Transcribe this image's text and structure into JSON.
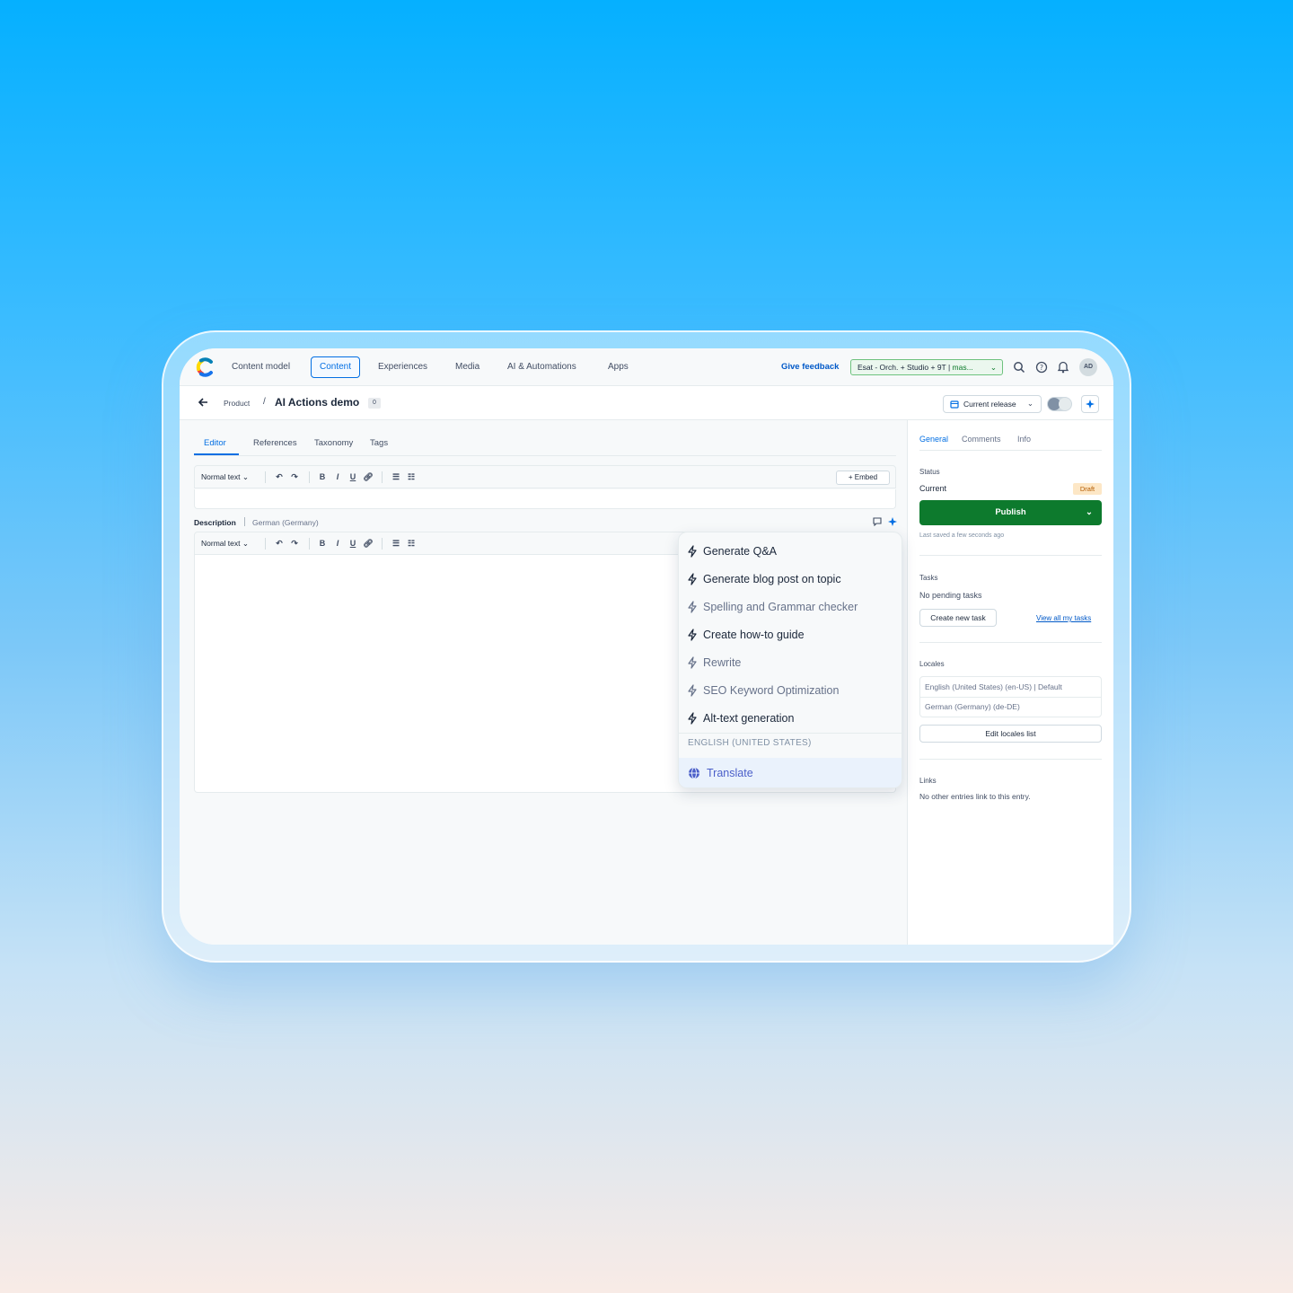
{
  "nav": {
    "items": [
      "Content model",
      "Content",
      "Experiences",
      "Media",
      "AI & Automations",
      "Apps"
    ],
    "active": "Content",
    "feedback": "Give feedback",
    "env_label": "Esat - Orch. + Studio + 9T |",
    "env_branch": "mas...",
    "avatar": "AD"
  },
  "breadcrumb": {
    "parent": "Product",
    "separator": "/",
    "title": "AI Actions demo",
    "count": "0",
    "release": "Current release"
  },
  "editor": {
    "tabs": [
      "Editor",
      "References",
      "Taxonomy",
      "Tags"
    ],
    "toolbar": {
      "style": "Normal text",
      "embed": "+ Embed",
      "bold": "B",
      "italic": "I",
      "underline": "U"
    },
    "description_label": "Description",
    "description_locale": "German (Germany)"
  },
  "ai_menu": {
    "items": [
      {
        "label": "Generate Q&A",
        "muted": false
      },
      {
        "label": "Generate blog post on topic",
        "muted": false
      },
      {
        "label": "Spelling and Grammar checker",
        "muted": true
      },
      {
        "label": "Create how-to guide",
        "muted": false
      },
      {
        "label": "Rewrite",
        "muted": true
      },
      {
        "label": "SEO Keyword Optimization",
        "muted": true
      },
      {
        "label": "Alt-text generation",
        "muted": false
      }
    ],
    "section_header": "ENGLISH (UNITED STATES)",
    "translate": "Translate"
  },
  "sidebar": {
    "tabs": [
      "General",
      "Comments",
      "Info"
    ],
    "status_label": "Status",
    "status_value": "Current",
    "status_badge": "Draft",
    "publish": "Publish",
    "last_saved": "Last saved a few seconds ago",
    "tasks_label": "Tasks",
    "tasks_value": "No pending tasks",
    "create_task": "Create new task",
    "view_tasks": "View all my tasks",
    "locales_label": "Locales",
    "locales": [
      "English (United States) (en-US) | Default",
      "German (Germany) (de-DE)"
    ],
    "edit_locales": "Edit locales list",
    "links_label": "Links",
    "links_value": "No other entries link to this entry."
  },
  "colors": {
    "accent": "#036fe3",
    "publish_green": "#0d7a2d",
    "draft_bg": "#fde7c6",
    "translate_purple": "#4b5fc9"
  }
}
